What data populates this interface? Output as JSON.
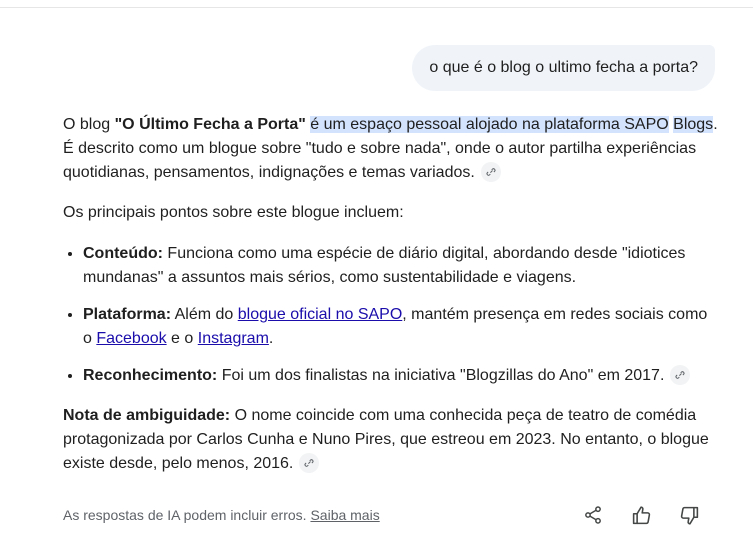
{
  "query": {
    "text": "o que é o blog o ultimo fecha a porta?"
  },
  "answer": {
    "intro_prefix": "O blog ",
    "intro_bold": "\"O Último Fecha a Porta\"",
    "intro_space": " ",
    "intro_highlight_1": "é um espaço pessoal alojado na plataforma SAPO",
    "intro_highlight_2": "Blogs",
    "intro_rest": ". É descrito como um blogue sobre \"tudo e sobre nada\", onde o autor partilha experiências quotidianas, pensamentos, indignações e temas variados.",
    "points_intro": "Os principais pontos sobre este blogue incluem:",
    "bullets": [
      {
        "label": "Conteúdo:",
        "text": " Funciona como uma espécie de diário digital, abordando desde \"idiotices mundanas\" a assuntos mais sérios, como sustentabilidade e viagens."
      },
      {
        "label": "Plataforma:",
        "text_1": " Além do ",
        "link_1": "blogue oficial no SAPO",
        "text_2": ", mantém presença em redes sociais como o ",
        "link_2": "Facebook",
        "text_3": " e o ",
        "link_3": "Instagram",
        "text_4": "."
      },
      {
        "label": "Reconhecimento:",
        "text": " Foi um dos finalistas na iniciativa \"Blogzillas do Ano\" em 2017."
      }
    ],
    "note_label": "Nota de ambiguidade:",
    "note_text": " O nome coincide com uma conhecida peça de teatro de comédia protagonizada por Carlos Cunha e Nuno Pires, que estreou em 2023. No entanto, o blogue existe desde, pelo menos, 2016."
  },
  "footer": {
    "disclaimer": "As respostas de IA podem incluir erros.",
    "learn_more": "Saiba mais"
  },
  "icons": {
    "source_link": "link-icon",
    "share": "share-icon",
    "thumbs_up": "thumbs-up-icon",
    "thumbs_down": "thumbs-down-icon"
  },
  "colors": {
    "highlight": "#d3e3fd",
    "link": "#1a0dab",
    "query_bubble": "#f0f4f9"
  }
}
